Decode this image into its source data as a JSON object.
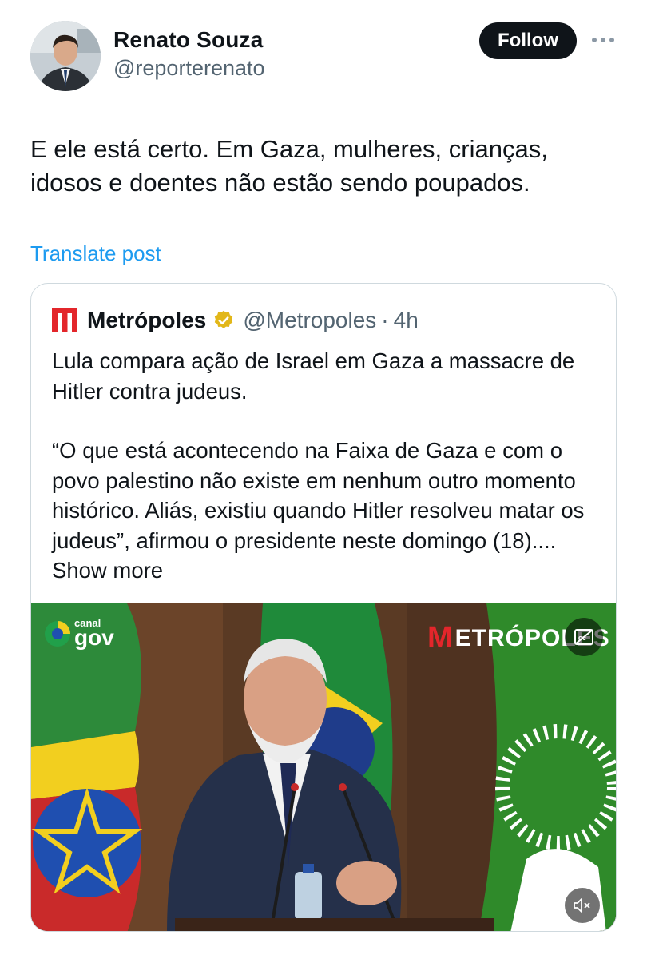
{
  "author": {
    "display_name": "Renato Souza",
    "handle": "@reporterenato",
    "follow_label": "Follow"
  },
  "post": {
    "text": "E ele está certo. Em Gaza, mulheres, crianças, idosos e doentes não estão sendo poupados.",
    "translate_label": "Translate post"
  },
  "quoted": {
    "name": "Metrópoles",
    "handle": "@Metropoles",
    "separator": "·",
    "time": "4h",
    "paragraph1": "Lula compara ação de Israel em Gaza a massacre de Hitler contra judeus.",
    "paragraph2": "“O que está acontecendo na Faixa de Gaza e com o povo palestino não existe em nenhum outro momento histórico. Aliás, existiu quando Hitler resolveu matar os judeus”, afirmou o presidente neste domingo (18)....",
    "show_more": "Show more"
  },
  "media": {
    "canal_small": "canal",
    "canal_big": "gov",
    "watermark_m": "M",
    "watermark_rest": "ETRÓPOLES"
  },
  "colors": {
    "link": "#1d9bf0",
    "follow_bg": "#0f1419",
    "border": "#cfd9de",
    "verified_gold": "#e2b719",
    "metropoles_red": "#e3262b"
  },
  "icons": [
    "more-icon",
    "verified-badge-icon",
    "metropoles-logo-icon",
    "closed-captions-icon",
    "mute-icon"
  ]
}
